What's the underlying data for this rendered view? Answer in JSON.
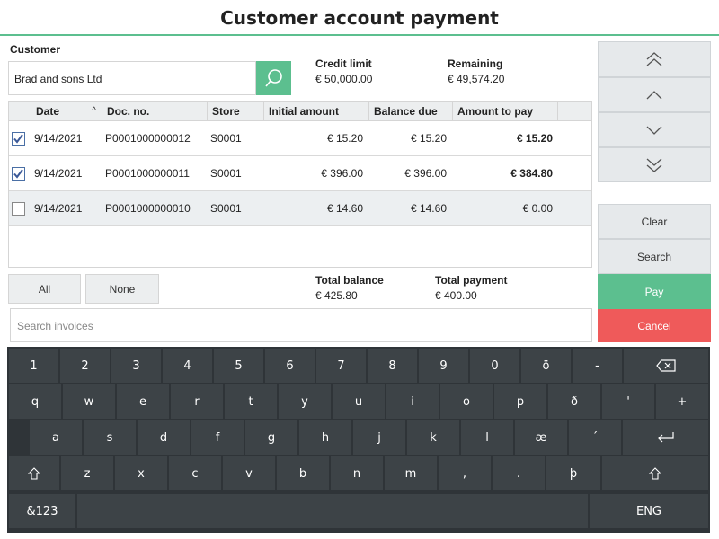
{
  "header": {
    "title": "Customer account payment"
  },
  "customer": {
    "label": "Customer",
    "value": "Brad and sons Ltd",
    "search_icon": "search-icon"
  },
  "credit": {
    "label": "Credit limit",
    "value": "€ 50,000.00"
  },
  "remaining": {
    "label": "Remaining",
    "value": "€ 49,574.20"
  },
  "grid": {
    "columns": [
      "Date",
      "Doc. no.",
      "Store",
      "Initial amount",
      "Balance due",
      "Amount to pay"
    ],
    "rows": [
      {
        "checked": true,
        "date": "9/14/2021",
        "doc": "P0001000000012",
        "store": "S0001",
        "initial": "€ 15.20",
        "balance": "€ 15.20",
        "pay": "€ 15.20"
      },
      {
        "checked": true,
        "date": "9/14/2021",
        "doc": "P0001000000011",
        "store": "S0001",
        "initial": "€ 396.00",
        "balance": "€ 396.00",
        "pay": "€ 384.80"
      },
      {
        "checked": false,
        "date": "9/14/2021",
        "doc": "P0001000000010",
        "store": "S0001",
        "initial": "€ 14.60",
        "balance": "€ 14.60",
        "pay": "€ 0.00"
      }
    ]
  },
  "buttons": {
    "all": "All",
    "none": "None"
  },
  "total_balance": {
    "label": "Total balance",
    "value": "€ 425.80"
  },
  "total_payment": {
    "label": "Total payment",
    "value": "€ 400.00"
  },
  "search_invoices": {
    "placeholder": "Search invoices"
  },
  "side": {
    "clear": "Clear",
    "search": "Search",
    "pay": "Pay",
    "cancel": "Cancel"
  },
  "colors": {
    "accent": "#5cbf8f",
    "danger": "#ef5a5a",
    "keyboard_bg": "#2f3438",
    "key_bg": "#3d4347"
  },
  "keyboard": {
    "row1": [
      "1",
      "2",
      "3",
      "4",
      "5",
      "6",
      "7",
      "8",
      "9",
      "0",
      "ö",
      "-"
    ],
    "row2": [
      "q",
      "w",
      "e",
      "r",
      "t",
      "y",
      "u",
      "i",
      "o",
      "p",
      "ð",
      "'",
      "+"
    ],
    "row3": [
      "a",
      "s",
      "d",
      "f",
      "g",
      "h",
      "j",
      "k",
      "l",
      "æ",
      "´"
    ],
    "row4": [
      "z",
      "x",
      "c",
      "v",
      "b",
      "n",
      "m",
      ",",
      ".",
      "þ"
    ],
    "symbols": "&123",
    "language": "ENG"
  }
}
